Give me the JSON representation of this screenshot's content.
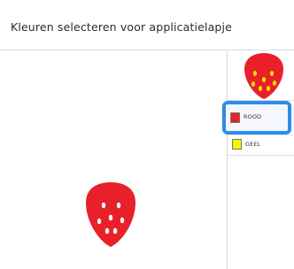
{
  "window": {
    "title": "Kleuren selecteren voor applicatielapje"
  },
  "colors": [
    {
      "label": "ROOD",
      "swatch": "#e8202a",
      "selected": true
    },
    {
      "label": "GEEL",
      "swatch": "#f5f500",
      "selected": false
    }
  ],
  "theme": {
    "selection_accent": "#2b8ee8",
    "strawberry_red": "#e8202a",
    "seed_white": "#ffffff",
    "seed_yellow": "#f5e000"
  },
  "icons": {
    "preview": "strawberry-icon",
    "thumbnail": "strawberry-thumbnail-icon"
  }
}
